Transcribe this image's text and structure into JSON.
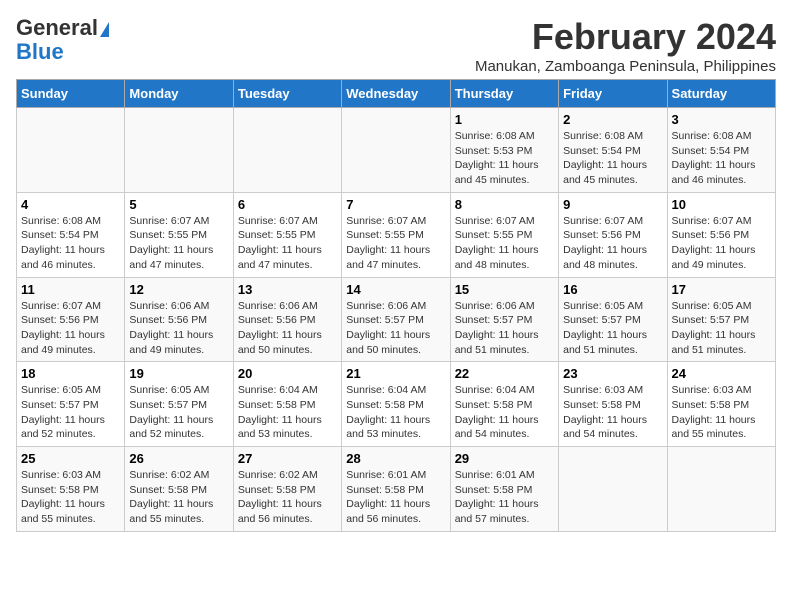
{
  "logo": {
    "line1": "General",
    "line2": "Blue"
  },
  "title": "February 2024",
  "subtitle": "Manukan, Zamboanga Peninsula, Philippines",
  "days_header": [
    "Sunday",
    "Monday",
    "Tuesday",
    "Wednesday",
    "Thursday",
    "Friday",
    "Saturday"
  ],
  "weeks": [
    [
      {
        "day": "",
        "info": ""
      },
      {
        "day": "",
        "info": ""
      },
      {
        "day": "",
        "info": ""
      },
      {
        "day": "",
        "info": ""
      },
      {
        "day": "1",
        "info": "Sunrise: 6:08 AM\nSunset: 5:53 PM\nDaylight: 11 hours and 45 minutes."
      },
      {
        "day": "2",
        "info": "Sunrise: 6:08 AM\nSunset: 5:54 PM\nDaylight: 11 hours and 45 minutes."
      },
      {
        "day": "3",
        "info": "Sunrise: 6:08 AM\nSunset: 5:54 PM\nDaylight: 11 hours and 46 minutes."
      }
    ],
    [
      {
        "day": "4",
        "info": "Sunrise: 6:08 AM\nSunset: 5:54 PM\nDaylight: 11 hours and 46 minutes."
      },
      {
        "day": "5",
        "info": "Sunrise: 6:07 AM\nSunset: 5:55 PM\nDaylight: 11 hours and 47 minutes."
      },
      {
        "day": "6",
        "info": "Sunrise: 6:07 AM\nSunset: 5:55 PM\nDaylight: 11 hours and 47 minutes."
      },
      {
        "day": "7",
        "info": "Sunrise: 6:07 AM\nSunset: 5:55 PM\nDaylight: 11 hours and 47 minutes."
      },
      {
        "day": "8",
        "info": "Sunrise: 6:07 AM\nSunset: 5:55 PM\nDaylight: 11 hours and 48 minutes."
      },
      {
        "day": "9",
        "info": "Sunrise: 6:07 AM\nSunset: 5:56 PM\nDaylight: 11 hours and 48 minutes."
      },
      {
        "day": "10",
        "info": "Sunrise: 6:07 AM\nSunset: 5:56 PM\nDaylight: 11 hours and 49 minutes."
      }
    ],
    [
      {
        "day": "11",
        "info": "Sunrise: 6:07 AM\nSunset: 5:56 PM\nDaylight: 11 hours and 49 minutes."
      },
      {
        "day": "12",
        "info": "Sunrise: 6:06 AM\nSunset: 5:56 PM\nDaylight: 11 hours and 49 minutes."
      },
      {
        "day": "13",
        "info": "Sunrise: 6:06 AM\nSunset: 5:56 PM\nDaylight: 11 hours and 50 minutes."
      },
      {
        "day": "14",
        "info": "Sunrise: 6:06 AM\nSunset: 5:57 PM\nDaylight: 11 hours and 50 minutes."
      },
      {
        "day": "15",
        "info": "Sunrise: 6:06 AM\nSunset: 5:57 PM\nDaylight: 11 hours and 51 minutes."
      },
      {
        "day": "16",
        "info": "Sunrise: 6:05 AM\nSunset: 5:57 PM\nDaylight: 11 hours and 51 minutes."
      },
      {
        "day": "17",
        "info": "Sunrise: 6:05 AM\nSunset: 5:57 PM\nDaylight: 11 hours and 51 minutes."
      }
    ],
    [
      {
        "day": "18",
        "info": "Sunrise: 6:05 AM\nSunset: 5:57 PM\nDaylight: 11 hours and 52 minutes."
      },
      {
        "day": "19",
        "info": "Sunrise: 6:05 AM\nSunset: 5:57 PM\nDaylight: 11 hours and 52 minutes."
      },
      {
        "day": "20",
        "info": "Sunrise: 6:04 AM\nSunset: 5:58 PM\nDaylight: 11 hours and 53 minutes."
      },
      {
        "day": "21",
        "info": "Sunrise: 6:04 AM\nSunset: 5:58 PM\nDaylight: 11 hours and 53 minutes."
      },
      {
        "day": "22",
        "info": "Sunrise: 6:04 AM\nSunset: 5:58 PM\nDaylight: 11 hours and 54 minutes."
      },
      {
        "day": "23",
        "info": "Sunrise: 6:03 AM\nSunset: 5:58 PM\nDaylight: 11 hours and 54 minutes."
      },
      {
        "day": "24",
        "info": "Sunrise: 6:03 AM\nSunset: 5:58 PM\nDaylight: 11 hours and 55 minutes."
      }
    ],
    [
      {
        "day": "25",
        "info": "Sunrise: 6:03 AM\nSunset: 5:58 PM\nDaylight: 11 hours and 55 minutes."
      },
      {
        "day": "26",
        "info": "Sunrise: 6:02 AM\nSunset: 5:58 PM\nDaylight: 11 hours and 55 minutes."
      },
      {
        "day": "27",
        "info": "Sunrise: 6:02 AM\nSunset: 5:58 PM\nDaylight: 11 hours and 56 minutes."
      },
      {
        "day": "28",
        "info": "Sunrise: 6:01 AM\nSunset: 5:58 PM\nDaylight: 11 hours and 56 minutes."
      },
      {
        "day": "29",
        "info": "Sunrise: 6:01 AM\nSunset: 5:58 PM\nDaylight: 11 hours and 57 minutes."
      },
      {
        "day": "",
        "info": ""
      },
      {
        "day": "",
        "info": ""
      }
    ]
  ]
}
